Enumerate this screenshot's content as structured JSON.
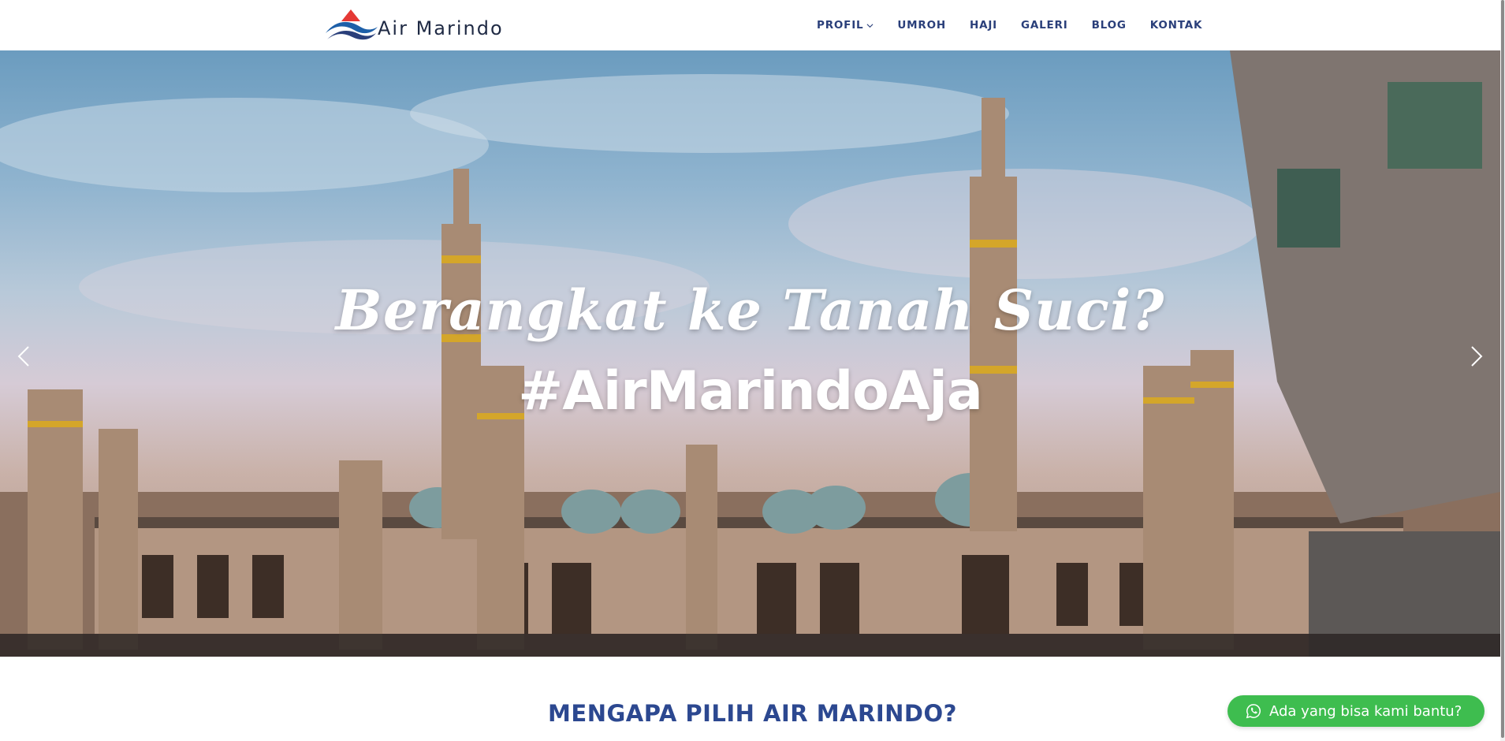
{
  "brand": {
    "name": "Air Marindo",
    "colors": {
      "red": "#e53935",
      "blue": "#2a3f7a",
      "navy": "#1f2a44"
    }
  },
  "nav": {
    "items": [
      {
        "label": "PROFIL",
        "has_dropdown": true
      },
      {
        "label": "UMROH"
      },
      {
        "label": "HAJI"
      },
      {
        "label": "GALERI"
      },
      {
        "label": "BLOG"
      },
      {
        "label": "KONTAK"
      }
    ]
  },
  "hero": {
    "title": "Berangkat ke Tanah Suci?",
    "tagline": "#AirMarindoAja",
    "prev_icon": "chevron-left-icon",
    "next_icon": "chevron-right-icon"
  },
  "section": {
    "title": "MENGAPA PILIH AIR MARINDO?"
  },
  "whatsapp": {
    "label": "Ada yang bisa kami bantu?",
    "icon": "whatsapp-icon",
    "color": "#3ebd4f"
  }
}
